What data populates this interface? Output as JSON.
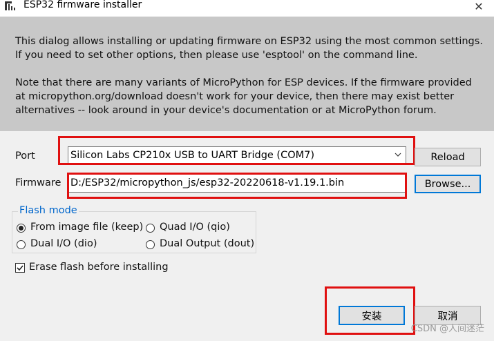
{
  "window": {
    "title": "ESP32 firmware installer",
    "close_glyph": "✕"
  },
  "info": {
    "paragraph1_line1": "This dialog allows installing or updating firmware on ESP32 using the most common settings.",
    "paragraph1_line2": "If you need to set other options, then please use 'esptool' on the command line.",
    "paragraph2_line1": "Note that there are many variants of MicroPython for ESP devices. If the firmware provided",
    "paragraph2_line2": "at micropython.org/download doesn't work for your device, then there may exist better",
    "paragraph2_line3": "alternatives -- look around in your device's documentation or at MicroPython forum."
  },
  "port": {
    "label": "Port",
    "value": "Silicon Labs CP210x USB to UART Bridge (COM7)",
    "reload_label": "Reload"
  },
  "firmware": {
    "label": "Firmware",
    "value": "D:/ESP32/micropython_js/esp32-20220618-v1.19.1.bin",
    "browse_label": "Browse..."
  },
  "flash_mode": {
    "legend": "Flash mode",
    "options": [
      {
        "label": "From image file (keep)",
        "selected": true
      },
      {
        "label": "Quad I/O (qio)",
        "selected": false
      },
      {
        "label": "Dual I/O (dio)",
        "selected": false
      },
      {
        "label": "Dual Output (dout)",
        "selected": false
      }
    ]
  },
  "erase": {
    "label": "Erase flash before installing",
    "checked": true
  },
  "actions": {
    "install_label": "安装",
    "cancel_label": "取消"
  },
  "watermark": "CSDN @人间迷茫",
  "colors": {
    "highlight_red": "#e01010",
    "legend_blue": "#0066cc",
    "info_bg": "#c8c8c8"
  }
}
